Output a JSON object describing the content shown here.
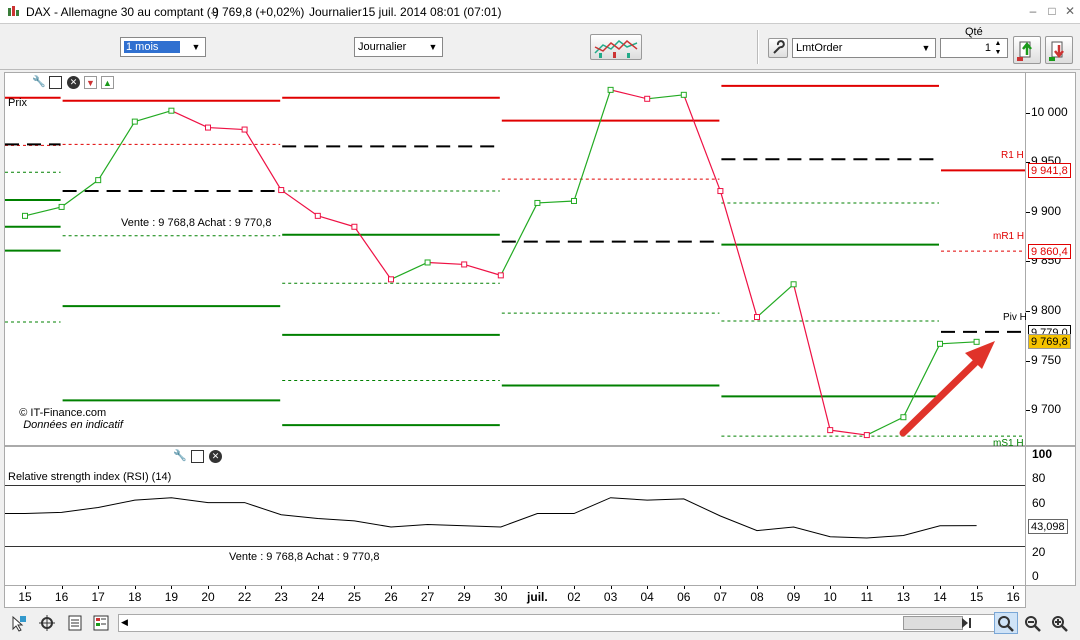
{
  "window": {
    "title": "DAX - Allemagne 30 au comptant (-)",
    "price": "9 769,8 (+0,02%)",
    "period": "Journalier",
    "datetime": "15 juil. 2014 08:01 (07:01)"
  },
  "toolbar": {
    "range_value": "1 mois",
    "interval_value": "Journalier",
    "order_type": "LmtOrder",
    "qty_label": "Qté",
    "qty_value": "1"
  },
  "price_panel": {
    "name": "Prix",
    "quote": "Vente : 9 768,8 Achat : 9 770,8",
    "footer": "© IT-Finance.com",
    "footer_note": "Données en indicatif"
  },
  "rsi_panel": {
    "name": "Relative strength index (RSI) (14)",
    "quote": "Vente : 9 768,8 Achat : 9 770,8",
    "current": "43,098"
  },
  "price_axis": {
    "ticks": [
      "10 000",
      "9 950",
      "9 900",
      "9 850",
      "9 800",
      "9 750",
      "9 700"
    ],
    "tags": [
      {
        "label": "R1 H",
        "value": "9 941,8",
        "color": "#e00000"
      },
      {
        "label": "mR1 H",
        "value": "9 860,4",
        "color": "#e00000"
      },
      {
        "label": "Piv H",
        "value": "9 779,0",
        "color": "#000000"
      },
      {
        "label": "",
        "value": "9 769,8",
        "color": "#000000"
      },
      {
        "label": "mS1 H",
        "value": "",
        "color": "#008000"
      }
    ]
  },
  "rsi_axis": {
    "ticks": [
      "100",
      "80",
      "60",
      "40",
      "20",
      "0"
    ]
  },
  "chart_data": [
    {
      "type": "line",
      "title": "DAX - Allemagne 30 au comptant (-)",
      "x": [
        "15",
        "16",
        "17",
        "18",
        "19",
        "20",
        "22",
        "23",
        "24",
        "25",
        "26",
        "27",
        "29",
        "30",
        "juil.",
        "02",
        "03",
        "04",
        "06",
        "07",
        "08",
        "09",
        "10",
        "11",
        "13",
        "14",
        "15",
        "16"
      ],
      "series": [
        {
          "name": "Prix",
          "values": [
            9896,
            9905,
            9932,
            9991,
            10002,
            9985,
            9983,
            9922,
            9896,
            9885,
            9832,
            9849,
            9847,
            9836,
            9909,
            9911,
            10023,
            10014,
            10018,
            9921,
            9794,
            9827,
            9680,
            9675,
            9693,
            9767,
            9769,
            null
          ]
        }
      ],
      "pivot_levels": [
        {
          "period": "15-16",
          "R1": 10015,
          "mR1": 9967,
          "Piv": 9968,
          "mS1": 9940,
          "S1": 9912,
          "S2": 9885,
          "S3": 9861,
          "mS2": 9789
        },
        {
          "period": "16-23",
          "R1": 10012,
          "mR1": 9968,
          "Piv": 9921,
          "mS1": 9876,
          "S1": 9805,
          "S2": 9710
        },
        {
          "period": "23-30",
          "R1": 10015,
          "Piv": 9966,
          "mS1": 9921,
          "S1": 9877,
          "mS2": 9828,
          "S2": 9776,
          "mS3": 9730,
          "S3": 9685
        },
        {
          "period": "30-07",
          "R1": 9992,
          "mR1": 9933,
          "Piv": 9870,
          "mS1": 9798,
          "S1": 9725,
          "mS2": 9664
        },
        {
          "period": "07-14",
          "R1": 10027,
          "Piv": 9953,
          "mS1": 9909,
          "S1": 9867,
          "mS2": 9790,
          "S2": 9714,
          "mS3": 9674
        },
        {
          "period": "14-16",
          "R1": 9941.8,
          "mR1": 9860.4,
          "Piv": 9779.0,
          "mS1": 9674
        }
      ],
      "ylim": [
        9665,
        10040
      ]
    },
    {
      "type": "line",
      "title": "Relative strength index (RSI) (14)",
      "x": [
        "15",
        "16",
        "17",
        "18",
        "19",
        "20",
        "22",
        "23",
        "24",
        "25",
        "26",
        "27",
        "29",
        "30",
        "juil.",
        "02",
        "03",
        "04",
        "06",
        "07",
        "08",
        "09",
        "10",
        "11",
        "13",
        "14",
        "15"
      ],
      "series": [
        {
          "name": "RSI",
          "values": [
            52,
            53,
            57,
            63,
            65,
            61,
            61,
            51,
            48,
            46,
            41,
            43,
            42,
            41,
            52,
            52,
            65,
            63,
            64,
            50,
            38,
            41,
            33,
            32,
            34,
            42,
            42.1
          ]
        }
      ],
      "levels": [
        75,
        25
      ],
      "ylim": [
        0,
        100
      ]
    }
  ]
}
